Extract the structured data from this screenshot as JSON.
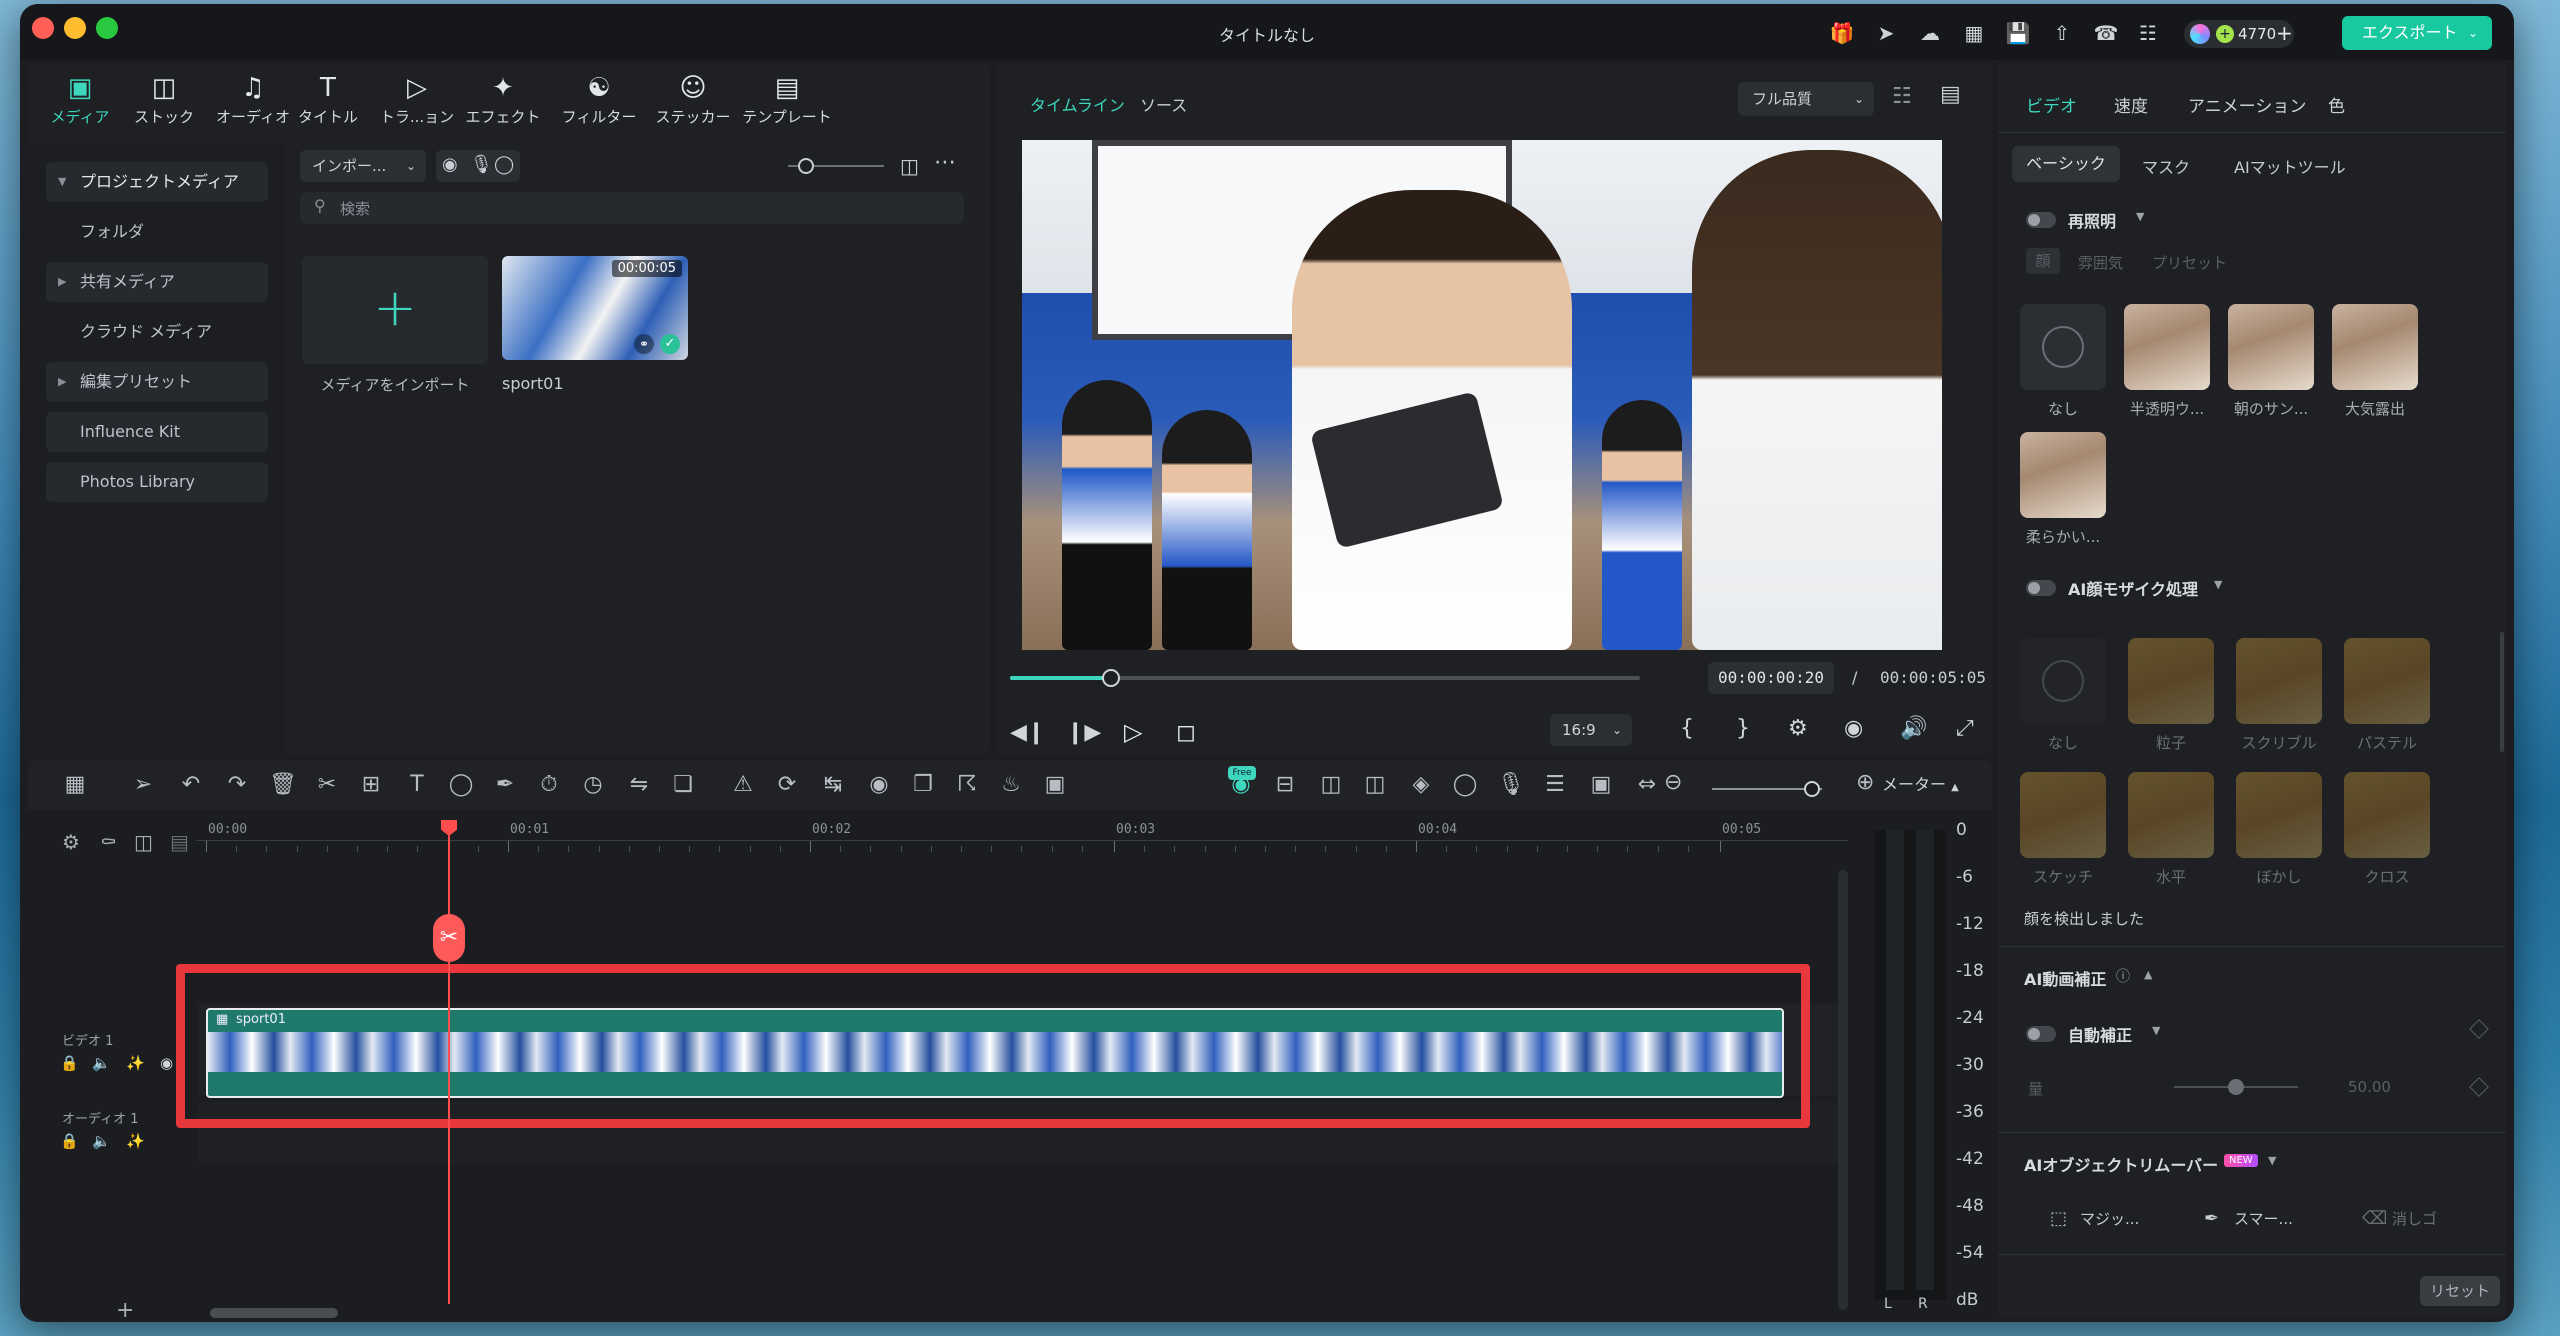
{
  "window": {
    "title": "タイトルなし"
  },
  "titlebar": {
    "credits": "4770",
    "export_label": "エクスポート"
  },
  "media_tools": [
    {
      "label": "メディア",
      "icon": "media-icon",
      "active": true
    },
    {
      "label": "ストック",
      "icon": "stock-icon"
    },
    {
      "label": "オーディオ",
      "icon": "audio-icon"
    },
    {
      "label": "タイトル",
      "icon": "title-icon"
    },
    {
      "label": "トラ...ョン",
      "icon": "transition-icon"
    },
    {
      "label": "エフェクト",
      "icon": "effect-icon"
    },
    {
      "label": "フィルター",
      "icon": "filter-icon"
    },
    {
      "label": "ステッカー",
      "icon": "sticker-icon"
    },
    {
      "label": "テンプレート",
      "icon": "template-icon"
    }
  ],
  "sidebar": {
    "items": [
      {
        "label": "プロジェクトメディア",
        "expanded": true
      },
      {
        "label": "フォルダ"
      },
      {
        "label": "共有メディア"
      },
      {
        "label": "クラウド メディア"
      },
      {
        "label": "編集プリセット"
      },
      {
        "label": "Influence Kit"
      },
      {
        "label": "Photos Library"
      }
    ]
  },
  "media_panel": {
    "import_dropdown": "インポー...",
    "search_placeholder": "検索",
    "import_tile_label": "メディアをインポート",
    "clip": {
      "name": "sport01",
      "duration": "00:00:05"
    }
  },
  "preview": {
    "tabs": [
      "タイムライン",
      "ソース"
    ],
    "quality": "フル品質",
    "current_time": "00:00:00:20",
    "separator": "/",
    "total_time": "00:00:05:05",
    "aspect": "16:9",
    "progress": 0.16
  },
  "timeline": {
    "ruler": [
      "00:00",
      "00:01",
      "00:02",
      "00:03",
      "00:04",
      "00:05"
    ],
    "meter_label": "メーター",
    "tracks": [
      {
        "name": "ビデオ 1",
        "clip": "sport01"
      },
      {
        "name": "オーディオ 1"
      }
    ],
    "db_scale": [
      "0",
      "-6",
      "-12",
      "-18",
      "-24",
      "-30",
      "-36",
      "-42",
      "-48",
      "-54",
      "dB"
    ],
    "lr": [
      "L",
      "R"
    ],
    "ai_badge": "Free"
  },
  "right_panel": {
    "tabs": [
      "ビデオ",
      "速度",
      "アニメーション",
      "色"
    ],
    "subtabs": [
      "ベーシック",
      "マスク",
      "AIマットツール"
    ],
    "relight": {
      "title": "再照明",
      "subtabs": [
        "顔",
        "雰囲気",
        "プリセット"
      ],
      "presets": [
        "なし",
        "半透明ウ...",
        "朝のサン...",
        "大気露出",
        "柔らかい..."
      ]
    },
    "mosaic": {
      "title": "AI顔モザイク処理",
      "presets": [
        "なし",
        "粒子",
        "スクリブル",
        "パステル",
        "スケッチ",
        "水平",
        "ぼかし",
        "クロス"
      ],
      "status": "顔を検出しました"
    },
    "enhance": {
      "title": "AI動画補正",
      "auto": "自動補正",
      "amount_label": "量",
      "amount": "50.00",
      "amount_fraction": 0.5
    },
    "remover": {
      "title": "AIオブジェクトリムーバー",
      "badge": "NEW",
      "tools": [
        "マジッ...",
        "スマー...",
        "消しゴ"
      ]
    },
    "reset": "リセット"
  },
  "colors": {
    "accent": "#3ed6bd",
    "playhead": "#ff4d4d",
    "highlight": "#e8383d",
    "clip": "#1f7a6b",
    "export": "#18c99f"
  }
}
